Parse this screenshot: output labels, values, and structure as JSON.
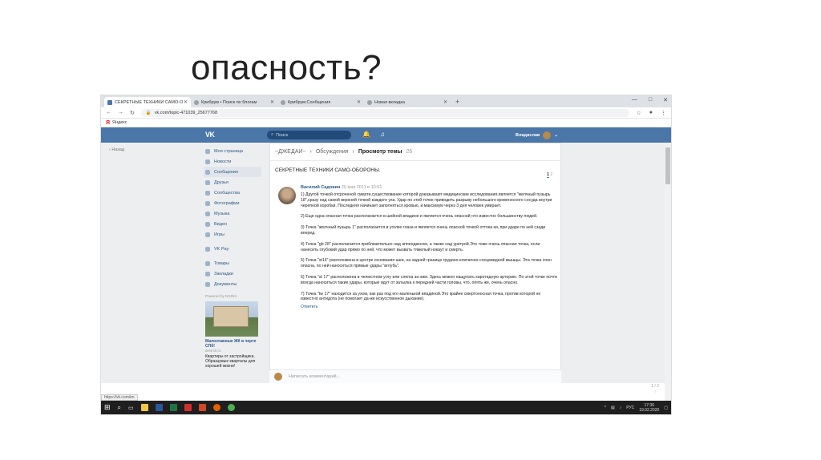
{
  "slide": {
    "title": "опасность?"
  },
  "browser": {
    "tabs": [
      {
        "label": "СЕКРЕТНЫЕ ТЕХНИКИ САМО-О",
        "active": true
      },
      {
        "label": "Крибрум • Поиск по блогам",
        "active": false
      },
      {
        "label": "Крибрум:Сообщения",
        "active": false
      },
      {
        "label": "Новая вкладка",
        "active": false
      }
    ],
    "new_tab": "+",
    "window_controls": [
      "—",
      "□",
      "✕"
    ],
    "url": "vk.com/topic-471039_25677768",
    "bookmark": "Яндекс",
    "status_url": "https://vk.com/im"
  },
  "vk": {
    "logo": "VK",
    "search_placeholder": "Поиск",
    "user_name": "Владислав",
    "back": "Назад",
    "menu": [
      {
        "label": "Моя страница",
        "icon": "home-icon"
      },
      {
        "label": "Новости",
        "icon": "news-icon"
      },
      {
        "label": "Сообщения",
        "icon": "message-icon",
        "selected": true
      },
      {
        "label": "Друзья",
        "icon": "friends-icon"
      },
      {
        "label": "Сообщества",
        "icon": "groups-icon"
      },
      {
        "label": "Фотографии",
        "icon": "photo-icon"
      },
      {
        "label": "Музыка",
        "icon": "music-icon"
      },
      {
        "label": "Видео",
        "icon": "video-icon"
      },
      {
        "label": "Игры",
        "icon": "games-icon"
      }
    ],
    "menu2": [
      {
        "label": "VK Pay",
        "icon": "vkpay-icon"
      }
    ],
    "menu3": [
      {
        "label": "Товары",
        "icon": "goods-icon"
      },
      {
        "label": "Закладки",
        "icon": "bookmark-icon"
      },
      {
        "label": "Документы",
        "icon": "docs-icon"
      }
    ],
    "powered": "Powered by NGINX",
    "ad": {
      "title": "Малоэтажные ЖК в черте СПб!",
      "site": "devimit.ru",
      "text": "Квартиры от застройщика. Образцовые кварталы для хорошей жизни!"
    },
    "breadcrumbs": {
      "group": "~ДЖЕДАИ~",
      "section": "Обсуждения",
      "current": "Просмотр темы",
      "count": "26"
    },
    "topic_title": "СЕКРЕТНЫЕ ТЕХНИКИ САМО-ОБОРОНЫ.",
    "pager": {
      "current": "1",
      "next": "2"
    },
    "post": {
      "author": "Василий Садовин",
      "date": "20 мая 2011 в 10:51",
      "paragraphs": [
        "1) Другой точкой отсроченой смерти,существование которой доказывают медицинские исследования,является \"желчный пузырь 18\",сразу над самой верхней точкой каждого уха. Удар по этой точке приводить разрыву небольшого кровеносного сосуда внутри черепной коробки. Последняя начинает заполняться кровью, и максимум через 3 дня человек умирает.",
        "2) Еще одна опасная точка располагается в шейной впадине и является очень опасной,что известно большинству людей.",
        "3) Точка \"желчный пузырь 1\" располагается в уголке глаза и является очень опасной точкой оттока ки, при ударе по ней сзади вперед.",
        "4) Точка \"gb 28\" располагается приблизительно над аппендиксом, а также над уретрой.Это тоже очень опасная точка, если нанесить глубокий удар прямо по ней, что может вызвать тяжелый нокаут и смерть.",
        "5) Точка \"st16\" расположена в центре основания шеи, на задней границе грудино-ключично-сосцевидной мышцы. Эта точка очен опасна, по ней наноситься прямые удары \"вглубь\".",
        "6) Точка \"st 17\" расположена в челюстном углу или слегка за ним. Здесь можно нащупать каротидную артерию. По этой точке почти всегда наноситься такие удары, которые идут от затылка к передней части головы, что, опять же, очень опасно.",
        "7) Точка \"tw 17\" находится за ухом, как раз под его маленькой впадиной.Это крайне смертоносная точка, против которой не известно антидота (не помогает да-же искусственное дыхание)."
      ],
      "reply": "Ответить"
    },
    "comment_placeholder": "Написать комментарий...",
    "page_counter": "1 / 2"
  },
  "taskbar": {
    "lang": "РУС",
    "time": "17:36",
    "date": "19.02.2020"
  }
}
